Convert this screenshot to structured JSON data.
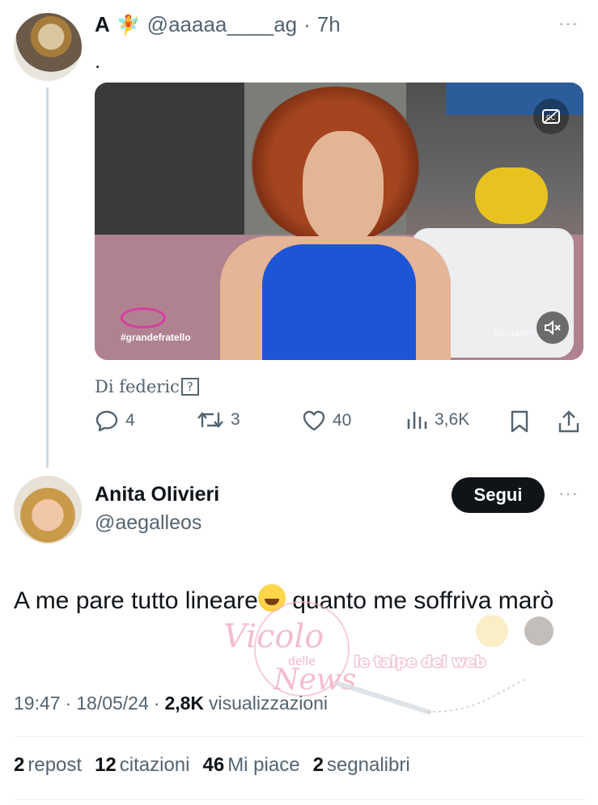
{
  "tweet1": {
    "display_name": "A",
    "name_emoji": "🧚",
    "handle": "@aaaaa____ag",
    "separator": "·",
    "time": "7h",
    "text": ".",
    "media": {
      "overlay_tag": "#grandefratello",
      "broadcaster": "MEDIASET"
    },
    "credit_prefix": "Di federic",
    "credit_box": "?",
    "actions": {
      "replies": "4",
      "reposts": "3",
      "likes": "40",
      "views": "3,6K"
    },
    "more_label": "···"
  },
  "tweet2": {
    "display_name": "Anita Olivieri",
    "handle": "@aegalleos",
    "follow_label": "Segui",
    "more_label": "···",
    "text_before_emoji": "A me pare tutto lineare",
    "text_after_emoji": " quanto me soffriva marò",
    "meta": {
      "time": "19:47",
      "sep1": "·",
      "date": "18/05/24",
      "sep2": "·",
      "views_count": "2,8K",
      "views_label": "visualizzazioni"
    },
    "stats": {
      "reposts_count": "2",
      "reposts_label": "repost",
      "quotes_count": "12",
      "quotes_label": "citazioni",
      "likes_count": "46",
      "likes_label": "Mi piace",
      "bookmarks_count": "2",
      "bookmarks_label": "segnalibri"
    }
  },
  "watermark": {
    "line1": "Vicolo",
    "line2": "delle",
    "line3": "News",
    "banner": "le talpe del web"
  },
  "colors": {
    "text": "#0f1419",
    "secondary": "#536471",
    "divider": "#eff3f4",
    "follow_bg": "#0f1419"
  }
}
